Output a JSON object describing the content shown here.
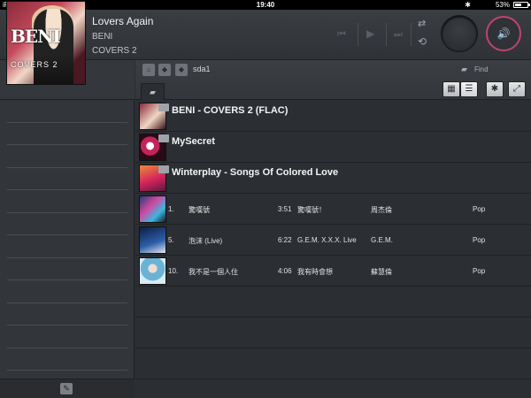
{
  "status_bar": {
    "device": "iPad",
    "time": "19:40",
    "battery": "53%",
    "bluetooth": "✱"
  },
  "now_playing": {
    "title": "Lovers Again",
    "artist": "BENI",
    "album": "COVERS 2",
    "cover": {
      "title_text": "BENI",
      "subtitle_text": "COVERS 2"
    }
  },
  "controls": {
    "prev": "⏮",
    "play": "▶",
    "next": "⏭",
    "shuffle": "⇄",
    "repeat": "⟲",
    "volume": "🔊"
  },
  "browser": {
    "path": "sda1",
    "find_label": "Find"
  },
  "folders": [
    {
      "title": "BENI - COVERS 2 (FLAC)"
    },
    {
      "title": "MySecret"
    },
    {
      "title": "Winterplay - Songs Of Colored Love"
    }
  ],
  "tracks": [
    {
      "num": "1.",
      "title": "驚嘆號",
      "time": "3:51",
      "album": "驚嘆號！",
      "artist": "周杰倫",
      "genre": "Pop"
    },
    {
      "num": "5.",
      "title": "泡沫 (Live)",
      "time": "6:22",
      "album": "G.E.M. X.X.X. Live",
      "artist": "G.E.M.",
      "genre": "Pop"
    },
    {
      "num": "10.",
      "title": "我不是一個人住",
      "time": "4:06",
      "album": "我有時會想",
      "artist": "蘇慧倫",
      "genre": "Pop"
    }
  ],
  "colors": {
    "accent": "#c2436b",
    "background": "#2b2e33",
    "sidebar": "#32353a"
  }
}
